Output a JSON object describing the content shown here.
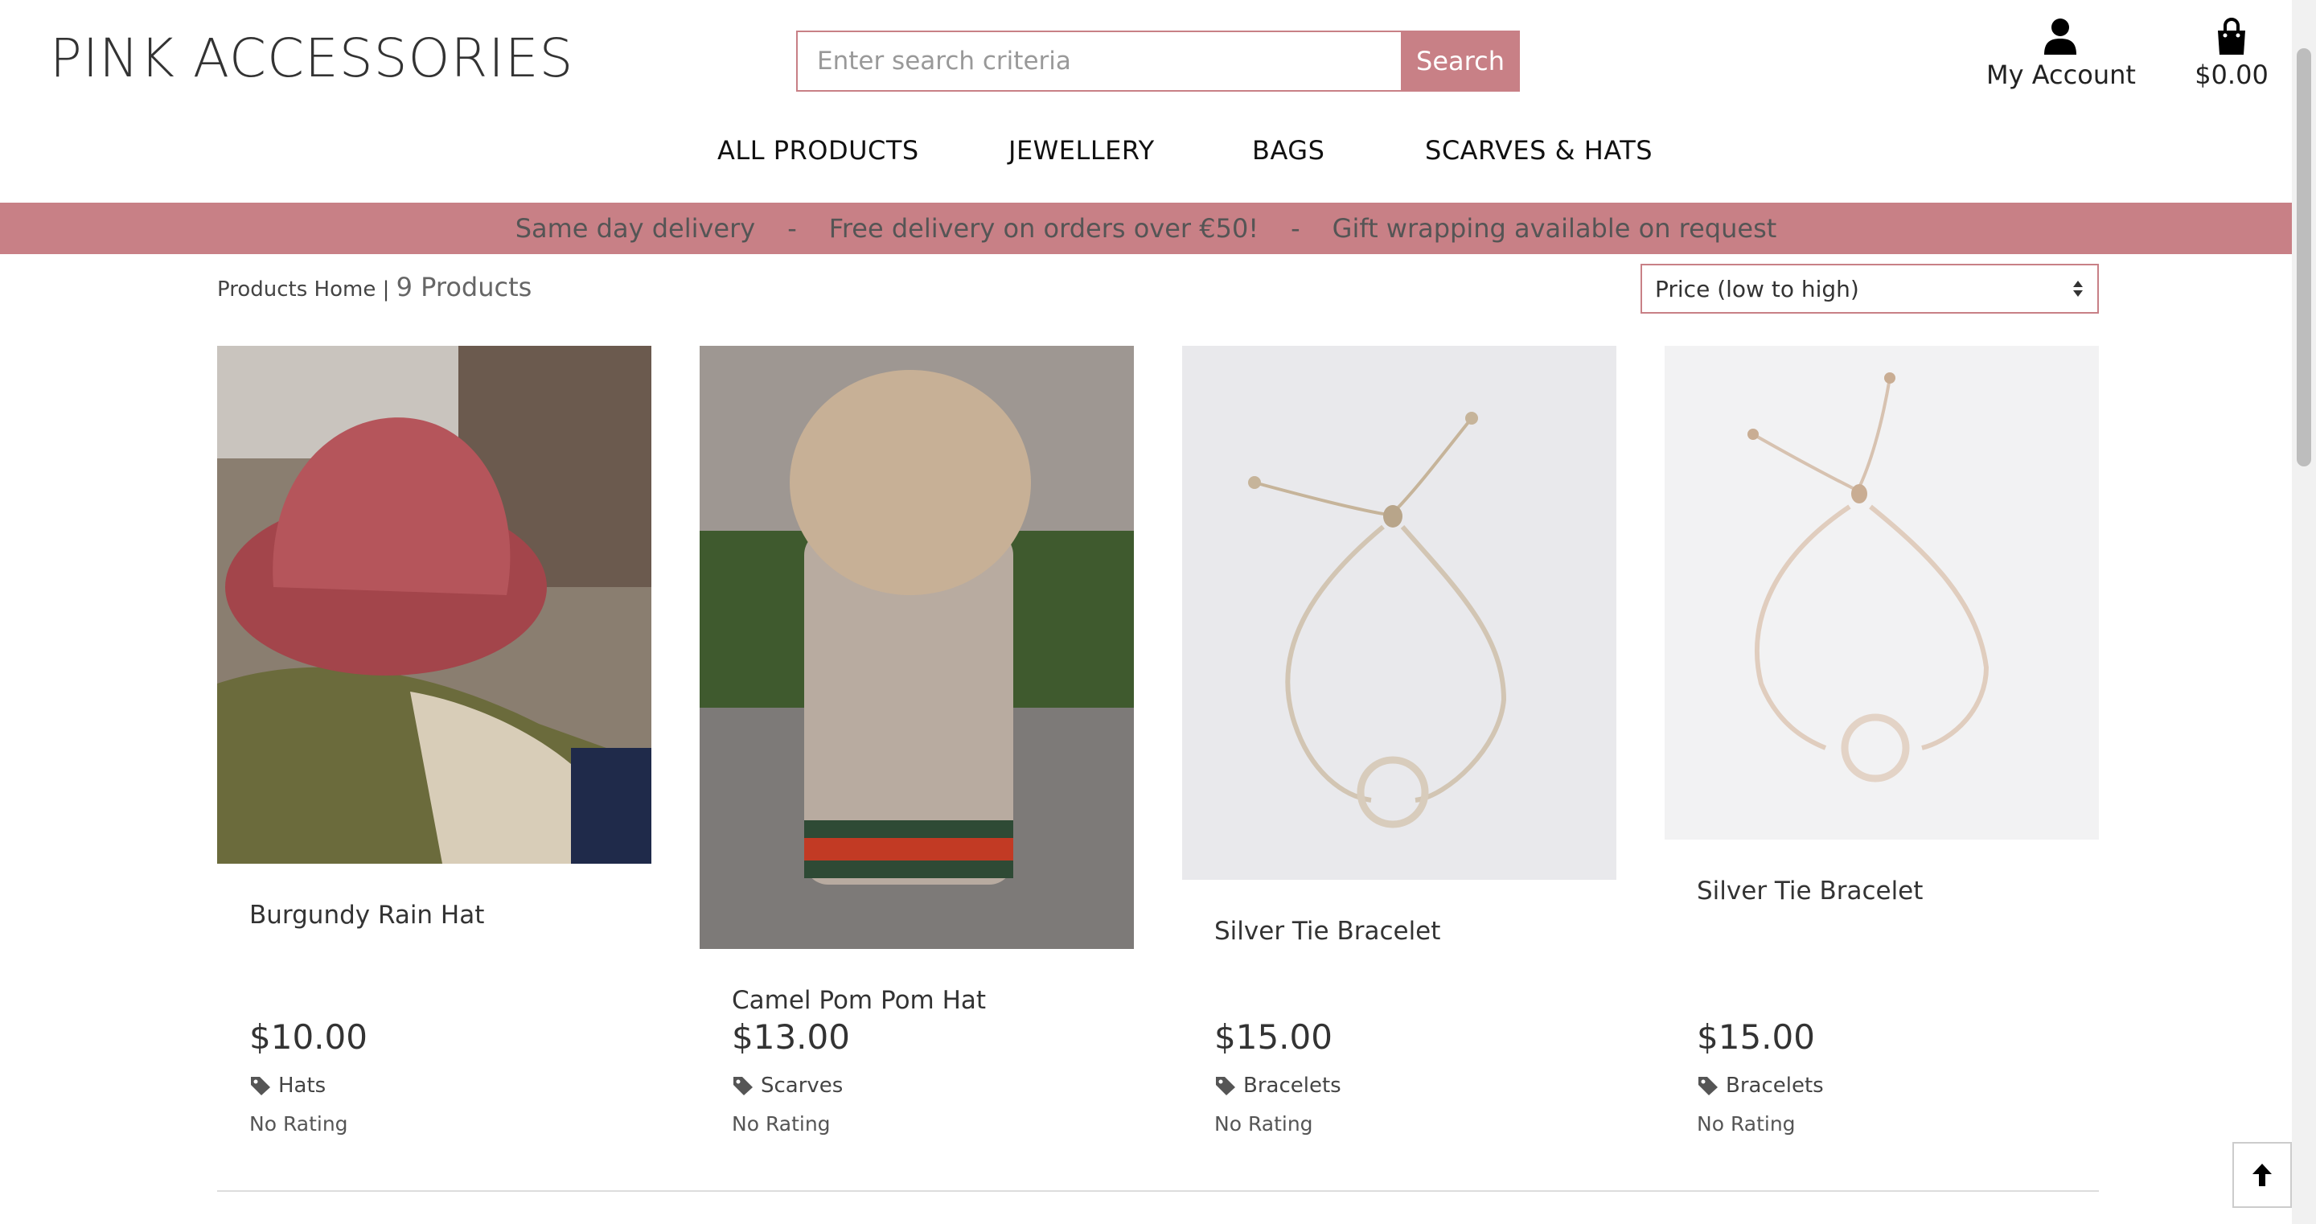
{
  "header": {
    "logo": "PINK ACCESSORIES",
    "search_placeholder": "Enter search criteria",
    "search_button": "Search",
    "account_label": "My Account",
    "cart_total": "$0.00"
  },
  "nav": {
    "items": [
      {
        "label": "ALL PRODUCTS"
      },
      {
        "label": "JEWELLERY"
      },
      {
        "label": "BAGS"
      },
      {
        "label": "SCARVES & HATS"
      }
    ]
  },
  "banner": {
    "item1": "Same day delivery",
    "sep": "-",
    "item2": "Free delivery on orders over €50!",
    "item3": "Gift wrapping available on request"
  },
  "toolbar": {
    "breadcrumb_link": "Products Home",
    "breadcrumb_sep": "|",
    "product_count": "9 Products",
    "sort_selected": "Price (low to high)"
  },
  "products": [
    {
      "name": "Burgundy Rain Hat",
      "price": "$10.00",
      "category": "Hats",
      "rating": "No Rating"
    },
    {
      "name": "Camel Pom Pom Hat",
      "price": "$13.00",
      "category": "Scarves",
      "rating": "No Rating"
    },
    {
      "name": "Silver Tie Bracelet",
      "price": "$15.00",
      "category": "Bracelets",
      "rating": "No Rating"
    },
    {
      "name": "Silver Tie Bracelet",
      "price": "$15.00",
      "category": "Bracelets",
      "rating": "No Rating"
    }
  ],
  "colors": {
    "brand_pink": "#c88086"
  },
  "icons": {
    "account": "user-icon",
    "cart": "shopping-bag-icon",
    "tag": "tag-icon",
    "sort": "sort-arrows-icon",
    "to_top": "arrow-up-icon"
  }
}
